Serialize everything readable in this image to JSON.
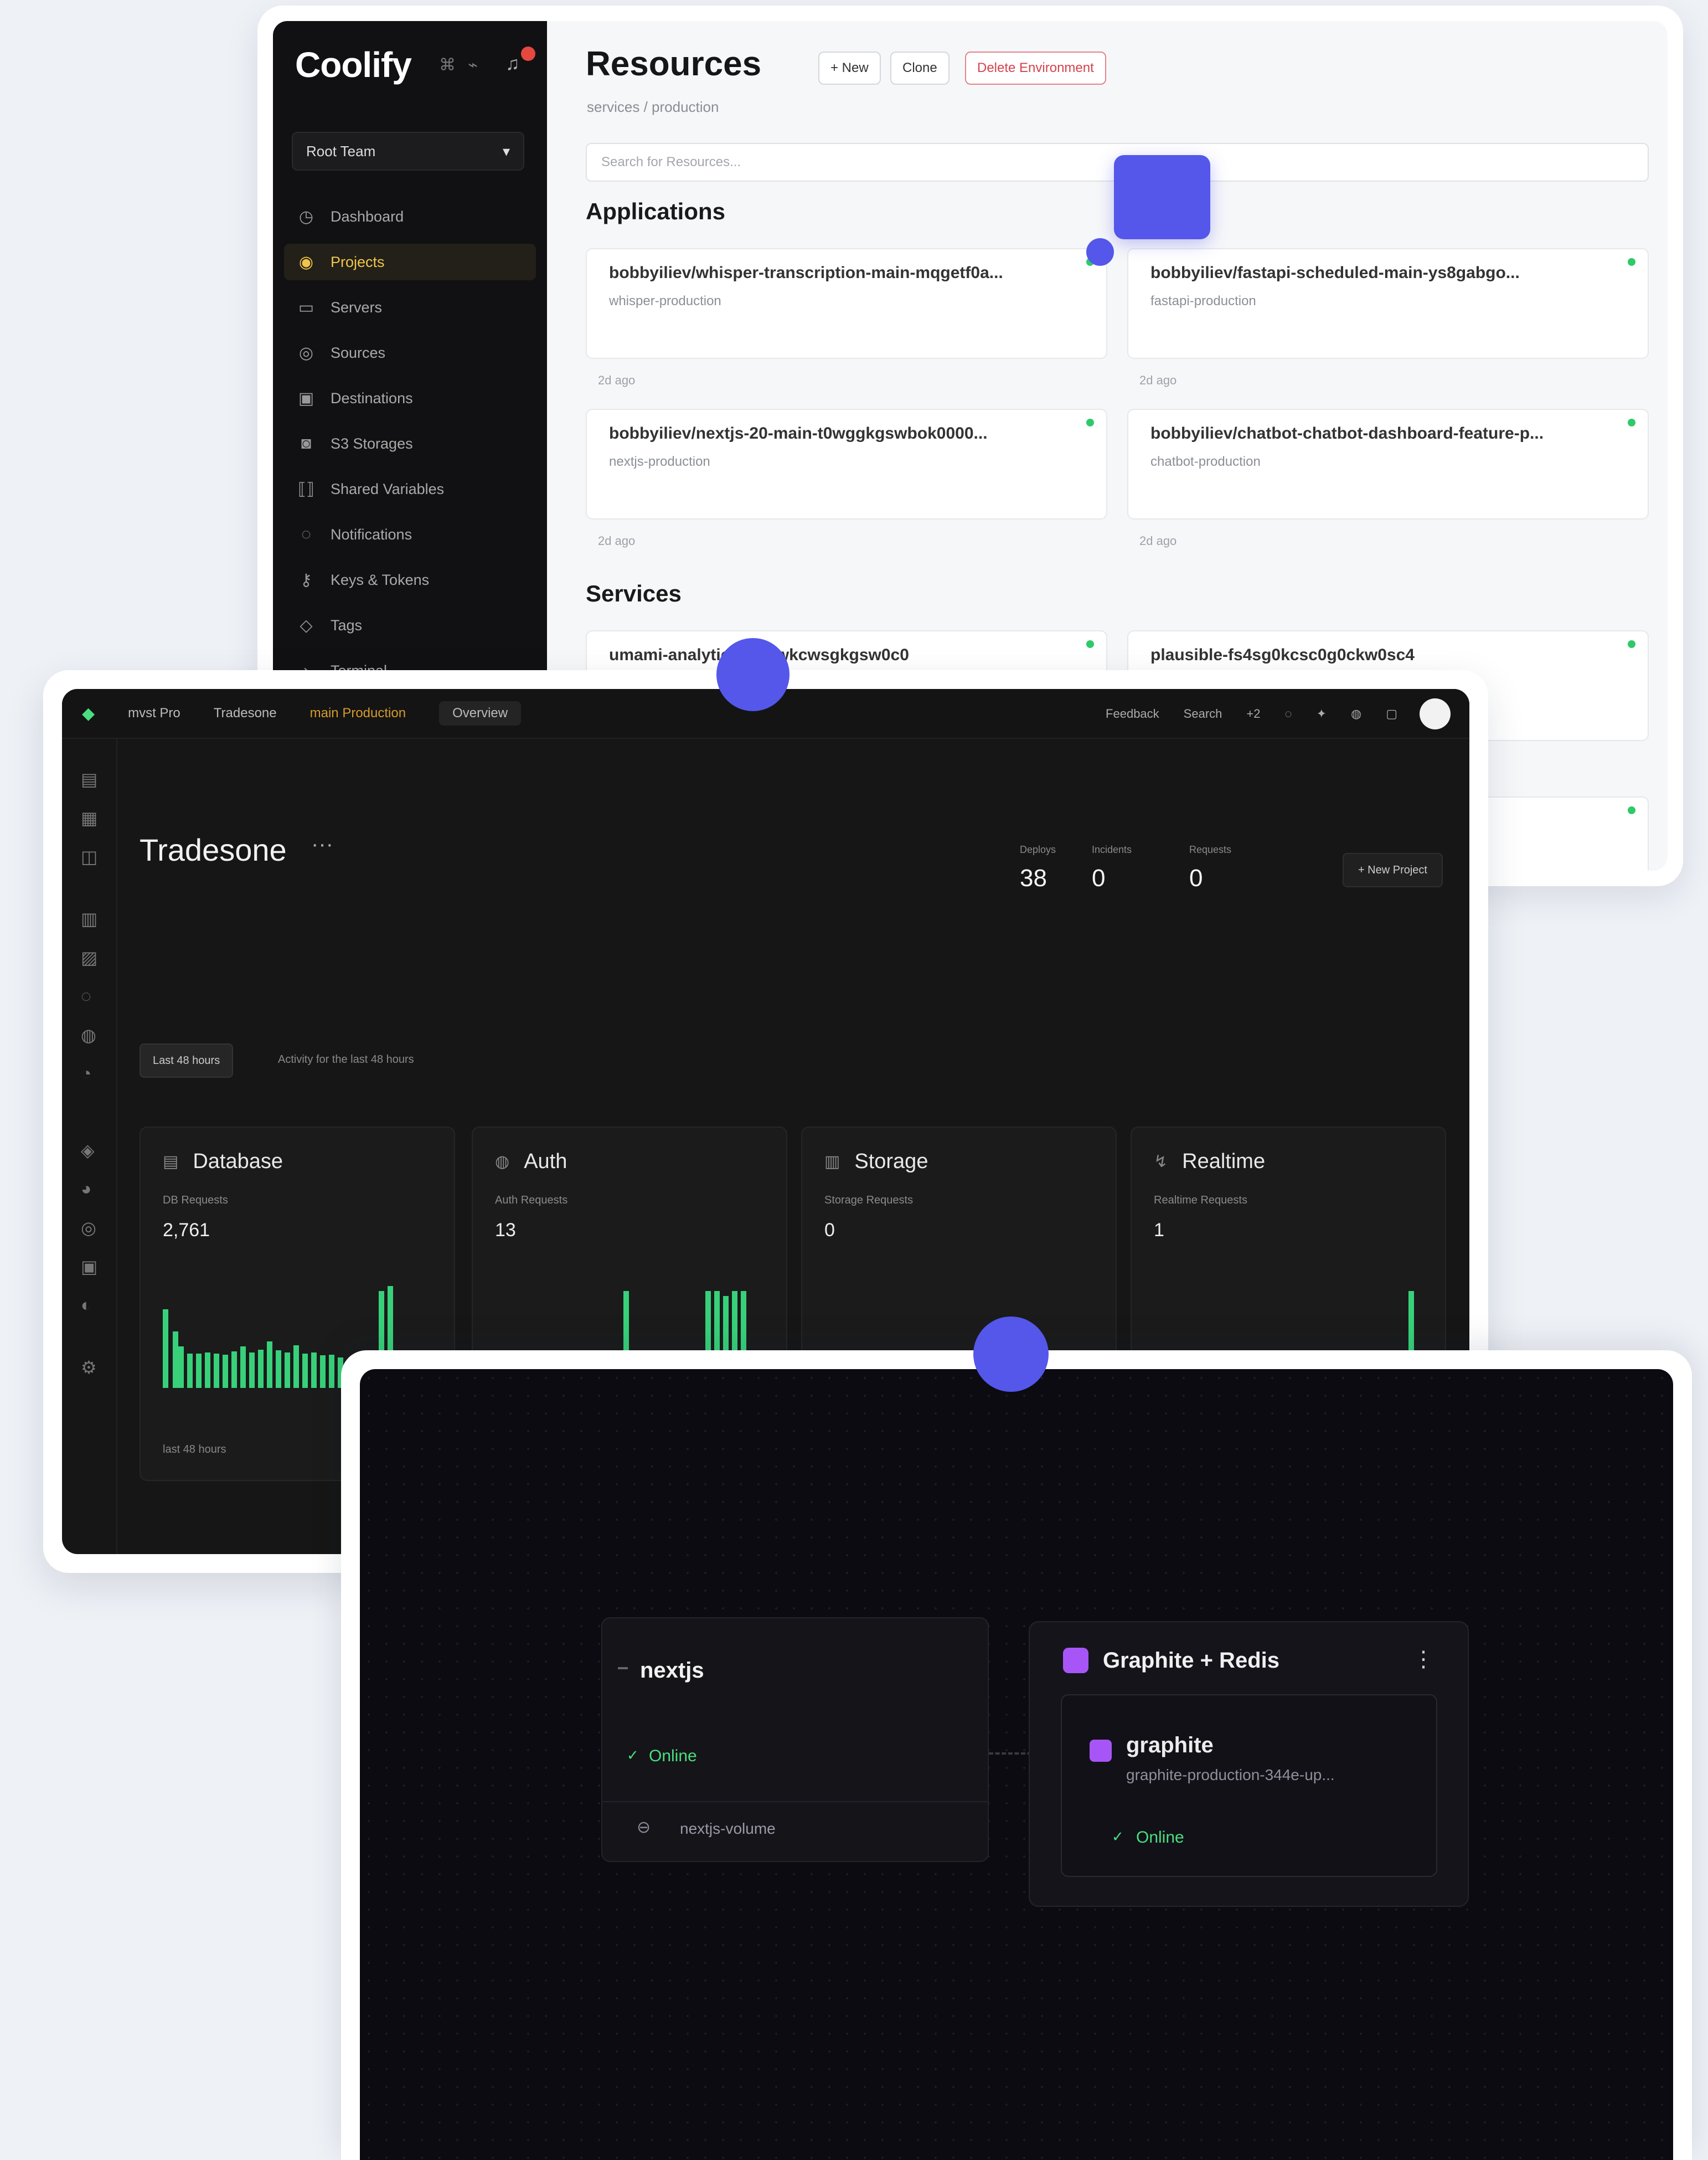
{
  "coolify": {
    "logo": "Coolify",
    "team": "Root Team",
    "nav": [
      {
        "label": "Dashboard",
        "icon": "home-icon"
      },
      {
        "label": "Projects",
        "icon": "layers-icon",
        "active": true
      },
      {
        "label": "Servers",
        "icon": "server-icon"
      },
      {
        "label": "Sources",
        "icon": "git-icon"
      },
      {
        "label": "Destinations",
        "icon": "box-icon"
      },
      {
        "label": "S3 Storages",
        "icon": "database-icon"
      },
      {
        "label": "Shared Variables",
        "icon": "variables-icon"
      },
      {
        "label": "Notifications",
        "icon": "bell-icon"
      },
      {
        "label": "Keys & Tokens",
        "icon": "key-icon"
      },
      {
        "label": "Tags",
        "icon": "tag-icon"
      },
      {
        "label": "Terminal",
        "icon": "terminal-icon"
      }
    ],
    "title": "Resources",
    "buttons": {
      "new": "+ New",
      "clone": "Clone",
      "delete": "Delete Environment"
    },
    "subtitle": "services / production",
    "search_placeholder": "Search for Resources...",
    "applications_heading": "Applications",
    "applications": [
      {
        "name": "bobbyiliev/whisper-transcription-main-mqgetf0a...",
        "desc": "whisper-production",
        "footer": "2d ago"
      },
      {
        "name": "bobbyiliev/fastapi-scheduled-main-ys8gabgo...",
        "desc": "fastapi-production",
        "footer": "2d ago"
      },
      {
        "name": "bobbyiliev/nextjs-20-main-t0wggkgswbok0000...",
        "desc": "nextjs-production",
        "footer": "2d ago"
      },
      {
        "name": "bobbyiliev/chatbot-chatbot-dashboard-feature-p...",
        "desc": "chatbot-production",
        "footer": "2d ago"
      }
    ],
    "services_heading": "Services",
    "services": [
      {
        "name": "umami-analytics-w0swkcwsgkgsw0c0"
      },
      {
        "name": "plausible-fs4sg0kcsc0g0ckw0sc4"
      }
    ],
    "status_color": "#2fc96b"
  },
  "dashboard": {
    "breadcrumbs": [
      "mvst  Pro",
      "Tradesone",
      "main  Production"
    ],
    "tab": "Overview",
    "top_right": {
      "feedback": "Feedback",
      "search": "Search",
      "badge": "+2"
    },
    "title": "Tradesone",
    "stats": [
      {
        "label": "Deploys",
        "value": "38"
      },
      {
        "label": "Incidents",
        "value": "0"
      },
      {
        "label": "Requests",
        "value": "0"
      }
    ],
    "new_button": "+ New Project",
    "filter": "Last 48 hours",
    "filter_note": "Activity for the last 48 hours",
    "cards": [
      {
        "title": "Database",
        "icon": "database-icon",
        "label": "DB Requests",
        "value": "2,761",
        "footer": "last 48 hours"
      },
      {
        "title": "Auth",
        "icon": "lock-icon",
        "label": "Auth Requests",
        "value": "13",
        "footer": ""
      },
      {
        "title": "Storage",
        "icon": "storage-icon",
        "label": "Storage Requests",
        "value": "0",
        "footer": ""
      },
      {
        "title": "Realtime",
        "icon": "realtime-icon",
        "label": "Realtime Requests",
        "value": "1",
        "footer": ""
      }
    ],
    "bar_color": "#38d17a"
  },
  "canvas": {
    "service": {
      "name": "nextjs",
      "status": "Online",
      "volume": "nextjs-volume"
    },
    "group": {
      "name": "Graphite + Redis",
      "more": "⋮"
    },
    "database": {
      "name": "graphite",
      "image": "graphite-production-344e-up...",
      "status": "Online"
    },
    "accent": "#a855f7",
    "online_color": "#4ade80"
  },
  "connector_color": "#5457ea"
}
